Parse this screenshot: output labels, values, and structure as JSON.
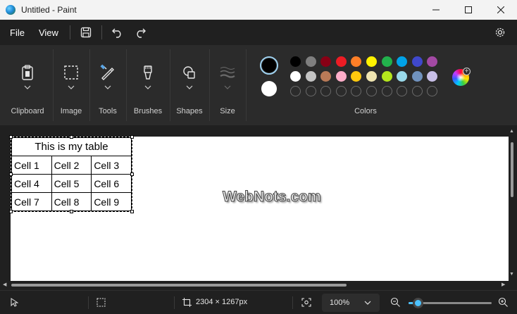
{
  "window": {
    "title": "Untitled - Paint"
  },
  "menu": {
    "file": "File",
    "view": "View"
  },
  "ribbon": {
    "groups": [
      "Clipboard",
      "Image",
      "Tools",
      "Brushes",
      "Shapes",
      "Size",
      "Colors"
    ]
  },
  "colors": {
    "primary": "#000000",
    "secondary": "#ffffff",
    "palette_row1": [
      "#000000",
      "#7f7f7f",
      "#880015",
      "#ed1c24",
      "#ff7f27",
      "#fff200",
      "#22b14c",
      "#00a2e8",
      "#3f48cc",
      "#a349a4"
    ],
    "palette_row2": [
      "#ffffff",
      "#c3c3c3",
      "#b97a57",
      "#ffaec9",
      "#ffc90e",
      "#efe4b0",
      "#b5e61d",
      "#99d9ea",
      "#7092be",
      "#c8bfe7"
    ]
  },
  "canvas": {
    "table": {
      "title": "This is my table",
      "rows": [
        [
          "Cell 1",
          "Cell 2",
          "Cell 3"
        ],
        [
          "Cell 4",
          "Cell 5",
          "Cell 6"
        ],
        [
          "Cell 7",
          "Cell 8",
          "Cell 9"
        ]
      ]
    },
    "watermark": "WebNots.com"
  },
  "status": {
    "image_size": "2304 × 1267px",
    "zoom": "100%",
    "zoom_level": 0.1
  }
}
